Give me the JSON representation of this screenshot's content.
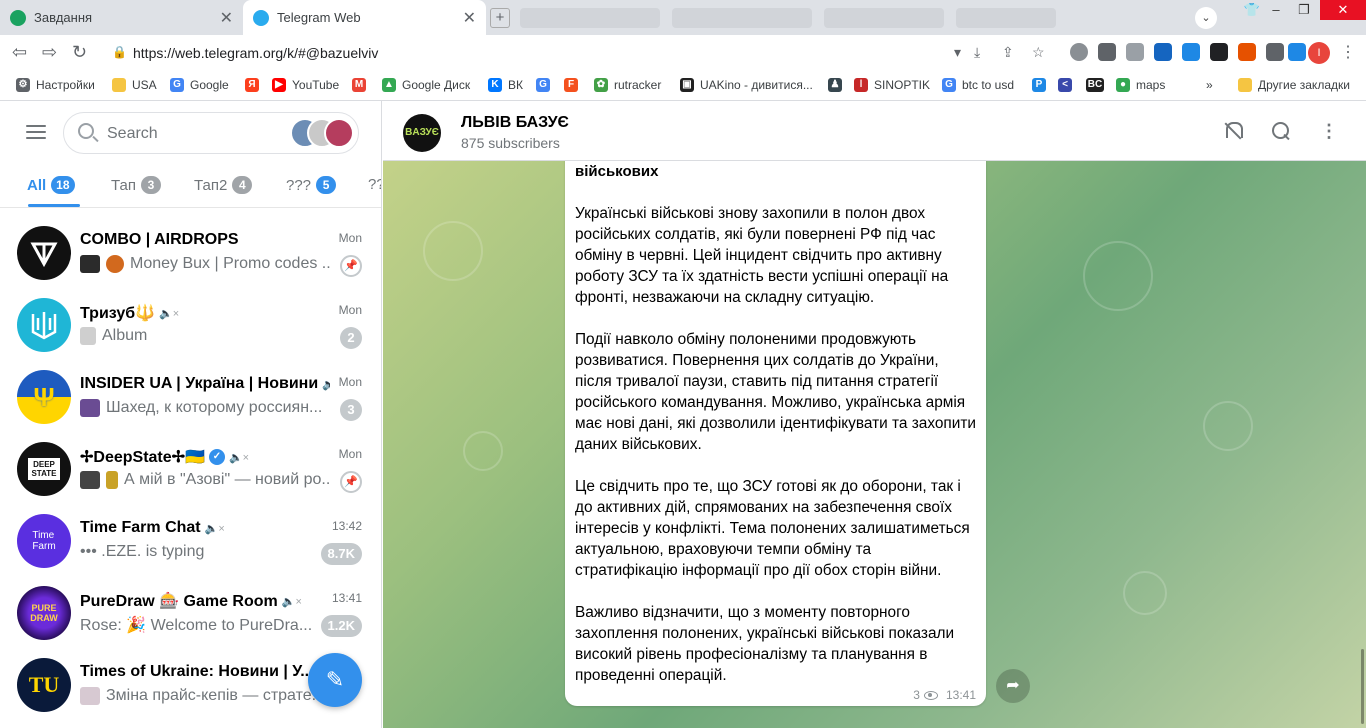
{
  "browser": {
    "tabs": [
      {
        "title": "Завдання",
        "favicon": "green-circle"
      },
      {
        "title": "Telegram Web",
        "favicon": "telegram"
      }
    ],
    "url": "https://web.telegram.org/k/#@bazuelviv",
    "bookmarks": [
      {
        "label": "Настройки"
      },
      {
        "label": "USA"
      },
      {
        "label": "Google"
      },
      {
        "label": ""
      },
      {
        "label": "YouTube"
      },
      {
        "label": ""
      },
      {
        "label": "Google Диск"
      },
      {
        "label": "ВК"
      },
      {
        "label": ""
      },
      {
        "label": ""
      },
      {
        "label": "rutracker"
      },
      {
        "label": "UAKino - дивитися..."
      },
      {
        "label": ""
      },
      {
        "label": "SINOPTIK"
      },
      {
        "label": "btc to usd"
      },
      {
        "label": ""
      },
      {
        "label": ""
      },
      {
        "label": ""
      },
      {
        "label": "maps"
      }
    ],
    "bookmarks_overflow": "»",
    "other_bookmarks": "Другие закладки",
    "profile_initial": "I"
  },
  "sidebar": {
    "search_placeholder": "Search",
    "folders": [
      {
        "label": "All",
        "count": "18"
      },
      {
        "label": "Тап",
        "count": "3"
      },
      {
        "label": "Тап2",
        "count": "4"
      },
      {
        "label": "???",
        "count": "5"
      },
      {
        "label": "??"
      }
    ],
    "chats": [
      {
        "name": "COMBO | AIRDROPS",
        "time": "Mon",
        "preview": "Money Bux | Promo codes ...",
        "pinned": true
      },
      {
        "name": "Тризуб🔱",
        "time": "Mon",
        "preview": "Album",
        "badge": "2",
        "muted": true
      },
      {
        "name": "INSIDER UA | Україна | Новини",
        "time": "Mon",
        "preview": "Шахед, к которому россиян...",
        "badge": "3",
        "muted": true
      },
      {
        "name": "✢DeepState✢🇺🇦",
        "time": "Mon",
        "preview": "А мій в \"Азові\" — новий ро...",
        "pinned": true,
        "verified": true,
        "muted": true
      },
      {
        "name": "Time Farm Chat",
        "time": "13:42",
        "preview": "••• .EZE. is typing",
        "badge": "8.7K",
        "muted": true
      },
      {
        "name": "PureDraw 🎰 Game Room",
        "time": "13:41",
        "preview": "Rose: 🎉 Welcome to PureDra...",
        "badge": "1.2K",
        "muted": true
      },
      {
        "name": "Times of Ukraine: Новини | У...",
        "time": "",
        "preview": "Зміна прайс-кепів — страте..."
      }
    ]
  },
  "channel": {
    "title": "ЛЬВІВ БАЗУЄ",
    "subscribers": "875 subscribers",
    "avatar_text": "BAЗУЄ"
  },
  "message": {
    "top_line": "військових",
    "paragraphs": [
      "Українські військові знову захопили в полон двох російських солдатів, які були повернені РФ під час обміну в червні. Цей інцидент свідчить про активну роботу ЗСУ та їх здатність вести успішні операції на фронті, незважаючи на складну ситуацію.",
      "Події навколо обміну полоненими продовжують розвиватися. Повернення цих солдатів до України, після тривалої паузи, ставить під питання стратегії російського командування. Можливо, українська армія має нові дані, які дозволили ідентифікувати та захопити даних військових.",
      "Це свідчить про те, що ЗСУ готові як до оборони, так і до активних дій, спрямованих на забезпечення своїх інтересів у конфлікті. Тема полонених залишатиметься актуальною, враховуючи темпи обміну та стратифікацію інформації про дії обох сторін війни.",
      "Важливо відзначити, що з моменту повторного захоплення полонених, українські військові показали високий рівень професіоналізму та планування в проведенні операцій."
    ],
    "views": "3",
    "time": "13:41"
  },
  "colors": {
    "telegram_blue": "#3390ec",
    "muted_badge": "#c4c9cc"
  }
}
